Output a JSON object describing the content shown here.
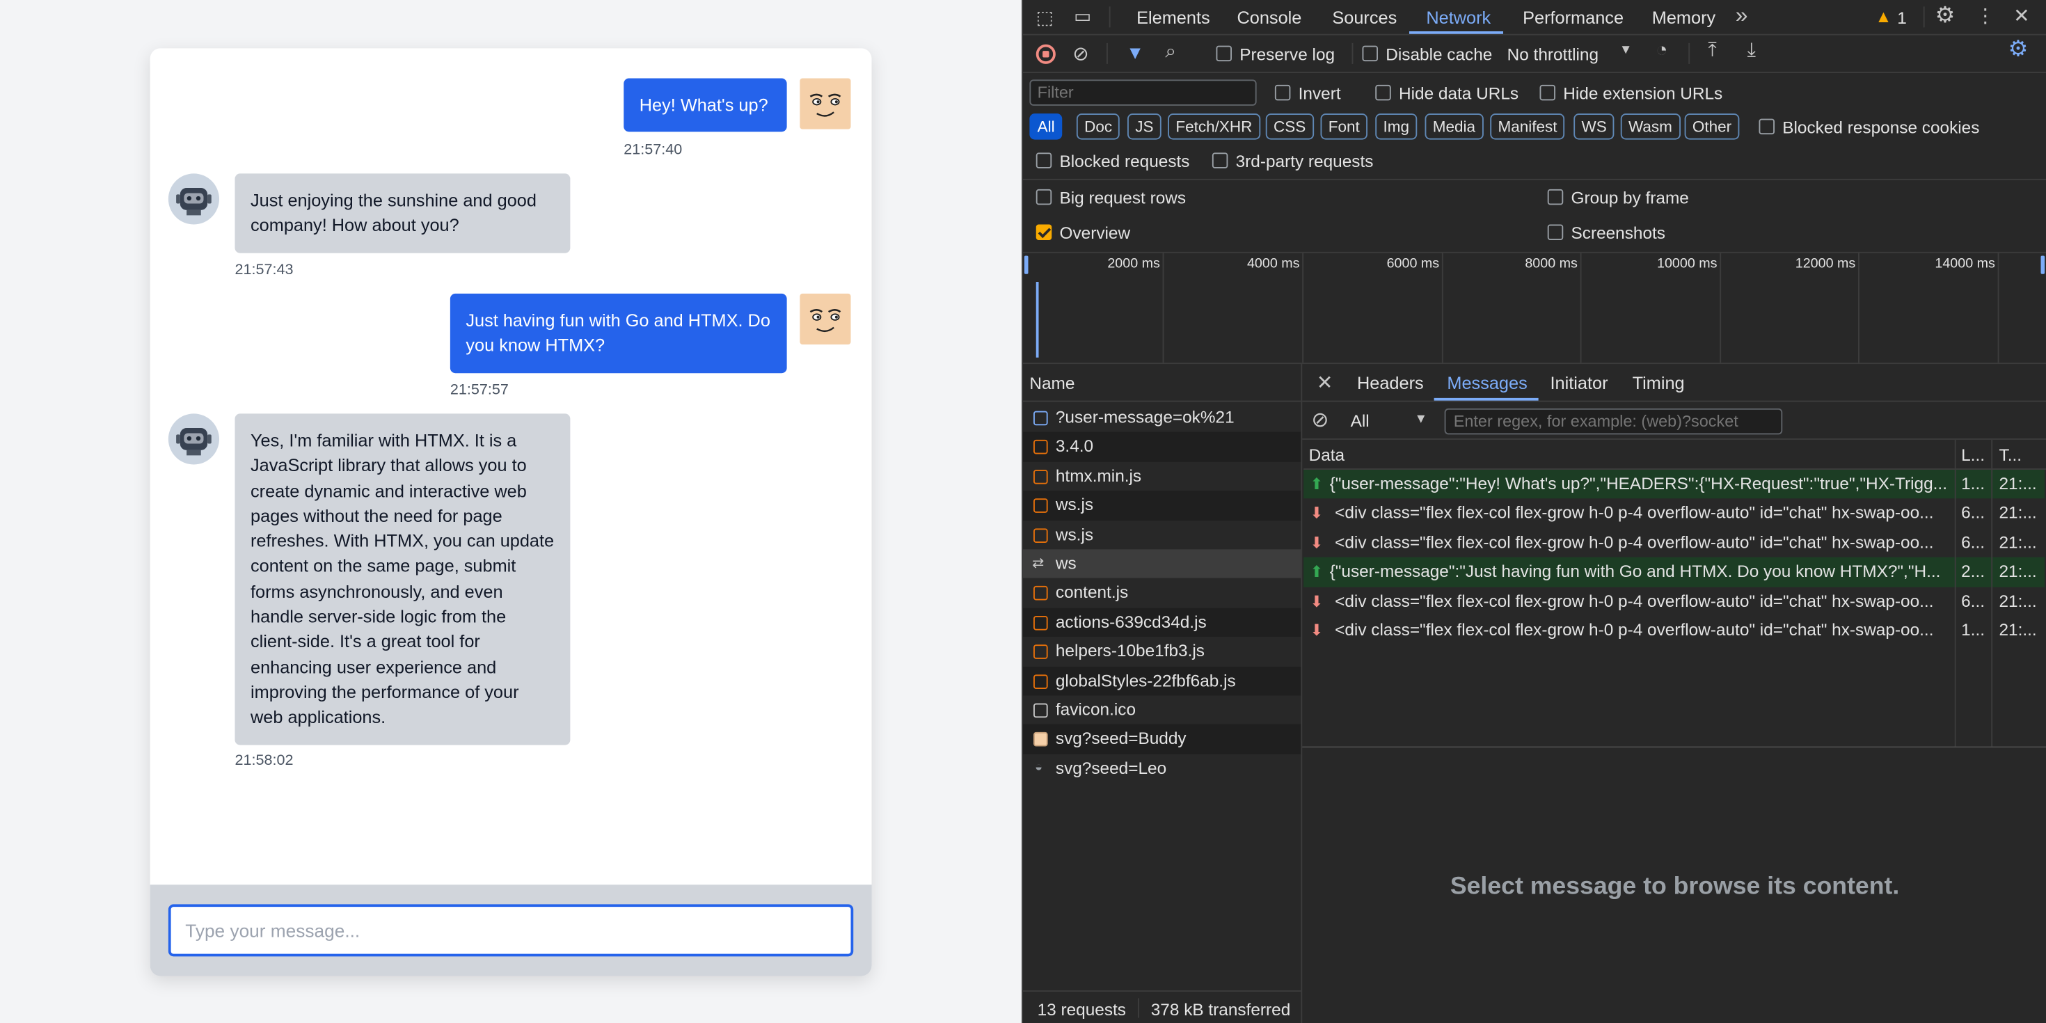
{
  "chat": {
    "messages": [
      {
        "role": "user",
        "text": "Hey! What's up?",
        "time": "21:57:40"
      },
      {
        "role": "bot",
        "text": "Just enjoying the sunshine and good company! How about you?",
        "time": "21:57:43"
      },
      {
        "role": "user",
        "text": "Just having fun with Go and HTMX. Do you know HTMX?",
        "time": "21:57:57"
      },
      {
        "role": "bot",
        "text": "Yes, I'm familiar with HTMX. It is a JavaScript library that allows you to create dynamic and interactive web pages without the need for page refreshes. With HTMX, you can update content on the same page, submit forms asynchronously, and even handle server-side logic from the client-side. It's a great tool for enhancing user experience and improving the performance of your web applications.",
        "time": "21:58:02"
      }
    ],
    "input_placeholder": "Type your message...",
    "input_value": ""
  },
  "devtools": {
    "panel_tabs": [
      "Elements",
      "Console",
      "Sources",
      "Network",
      "Performance",
      "Memory"
    ],
    "active_tab": "Network",
    "more_tabs": "»",
    "warning_count": "1",
    "toolbar": {
      "preserve_log": "Preserve log",
      "disable_cache": "Disable cache",
      "throttling": "No throttling"
    },
    "filter": {
      "placeholder": "Filter",
      "invert": "Invert",
      "hide_data_urls": "Hide data URLs",
      "hide_extension_urls": "Hide extension URLs"
    },
    "type_chips": [
      "All",
      "Doc",
      "JS",
      "Fetch/XHR",
      "CSS",
      "Font",
      "Img",
      "Media",
      "Manifest",
      "WS",
      "Wasm",
      "Other"
    ],
    "active_chip": "All",
    "blocked_response_cookies": "Blocked response cookies",
    "blocked_requests": "Blocked requests",
    "third_party": "3rd-party requests",
    "options": {
      "big_request_rows": "Big request rows",
      "group_by_frame": "Group by frame",
      "overview": "Overview",
      "screenshots": "Screenshots"
    },
    "timeline_ticks": [
      "2000 ms",
      "4000 ms",
      "6000 ms",
      "8000 ms",
      "10000 ms",
      "12000 ms",
      "14000 ms"
    ],
    "name_header": "Name",
    "requests": [
      {
        "name": "?user-message=ok%21",
        "type": "doc"
      },
      {
        "name": "3.4.0",
        "type": "script"
      },
      {
        "name": "htmx.min.js",
        "type": "script"
      },
      {
        "name": "ws.js",
        "type": "script"
      },
      {
        "name": "ws.js",
        "type": "script"
      },
      {
        "name": "ws",
        "type": "websocket"
      },
      {
        "name": "content.js",
        "type": "script"
      },
      {
        "name": "actions-639cd34d.js",
        "type": "script"
      },
      {
        "name": "helpers-10be1fb3.js",
        "type": "script"
      },
      {
        "name": "globalStyles-22fbf6ab.js",
        "type": "script"
      },
      {
        "name": "favicon.ico",
        "type": "other"
      },
      {
        "name": "svg?seed=Buddy",
        "type": "image"
      },
      {
        "name": "svg?seed=Leo",
        "type": "image"
      }
    ],
    "detail_tabs": [
      "Headers",
      "Messages",
      "Initiator",
      "Timing"
    ],
    "active_detail_tab": "Messages",
    "messages_filter": {
      "select_value": "All",
      "placeholder": "Enter regex, for example: (web)?socket"
    },
    "messages_columns": [
      "Data",
      "L...",
      "T..."
    ],
    "frames": [
      {
        "dir": "sent",
        "data": "{\"user-message\":\"Hey! What's up?\",\"HEADERS\":{\"HX-Request\":\"true\",\"HX-Trigg...",
        "len": "1...",
        "time": "21:..."
      },
      {
        "dir": "received",
        "data": "<div class=\"flex flex-col flex-grow h-0 p-4 overflow-auto\" id=\"chat\" hx-swap-oo...",
        "len": "6...",
        "time": "21:..."
      },
      {
        "dir": "received",
        "data": "<div class=\"flex flex-col flex-grow h-0 p-4 overflow-auto\" id=\"chat\" hx-swap-oo...",
        "len": "6...",
        "time": "21:..."
      },
      {
        "dir": "sent",
        "data": "{\"user-message\":\"Just having fun with Go and HTMX. Do you know HTMX?\",\"H...",
        "len": "2...",
        "time": "21:..."
      },
      {
        "dir": "received",
        "data": "<div class=\"flex flex-col flex-grow h-0 p-4 overflow-auto\" id=\"chat\" hx-swap-oo...",
        "len": "6...",
        "time": "21:..."
      },
      {
        "dir": "received",
        "data": "<div class=\"flex flex-col flex-grow h-0 p-4 overflow-auto\" id=\"chat\" hx-swap-oo...",
        "len": "1...",
        "time": "21:..."
      }
    ],
    "empty_message": "Select message to browse its content.",
    "status": {
      "requests": "13 requests",
      "transferred": "378 kB transferred"
    },
    "colors": {
      "accent": "#7cacf8",
      "sent_row": "#1c3d24",
      "sent_arrow": "#34a853",
      "recv_arrow": "#f28b82",
      "record": "#f28b82"
    }
  }
}
